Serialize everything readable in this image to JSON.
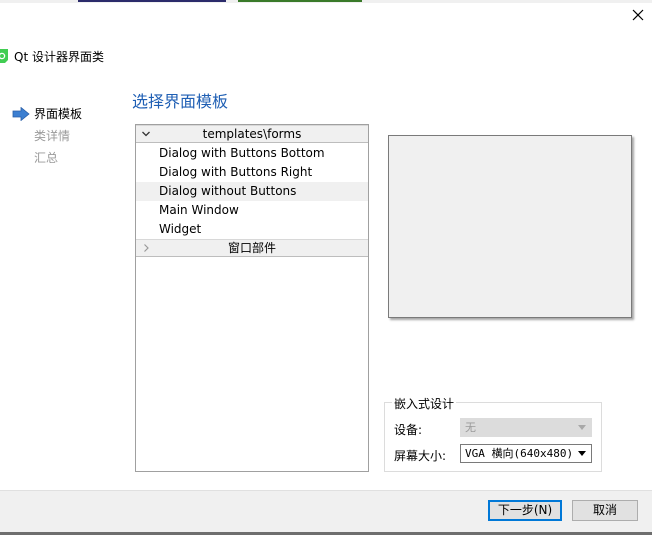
{
  "window": {
    "header_title": "Qt 设计器界面类",
    "logo_icon": "qt-logo-icon",
    "close_icon": "close-icon"
  },
  "steps": [
    {
      "label": "界面模板",
      "active": true
    },
    {
      "label": "类详情",
      "active": false
    },
    {
      "label": "汇总",
      "active": false
    }
  ],
  "page": {
    "title": "选择界面模板"
  },
  "tree": {
    "groups": [
      {
        "label": "templates\\forms",
        "expanded": true,
        "items": [
          {
            "label": "Dialog with Buttons Bottom",
            "selected": false
          },
          {
            "label": "Dialog with Buttons Right",
            "selected": false
          },
          {
            "label": "Dialog without Buttons",
            "selected": true
          },
          {
            "label": "Main Window",
            "selected": false
          },
          {
            "label": "Widget",
            "selected": false
          }
        ]
      },
      {
        "label": "窗口部件",
        "expanded": false,
        "items": []
      }
    ]
  },
  "embedded": {
    "group_title": "嵌入式设计",
    "device_label": "设备:",
    "device_value": "无",
    "device_enabled": false,
    "screen_label": "屏幕大小:",
    "screen_value": "VGA 横向(640x480)"
  },
  "footer": {
    "next_label": "下一步(N)",
    "cancel_label": "取消"
  },
  "colors": {
    "accent_blue": "#1f5fb4",
    "focus_blue": "#0078d7",
    "arrow_blue": "#3c7fd1",
    "qt_green": "#41cd52"
  }
}
